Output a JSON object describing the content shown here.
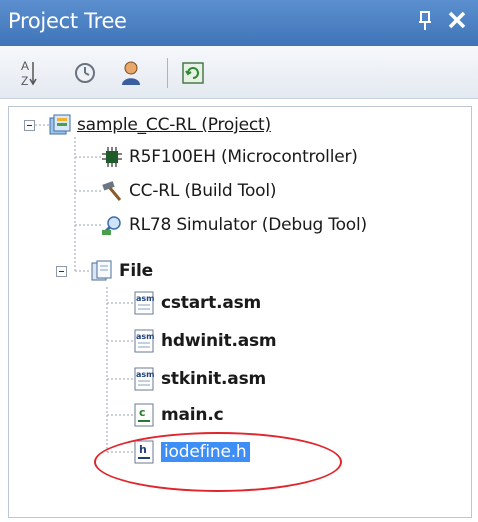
{
  "panel": {
    "title": "Project Tree",
    "close_label": "✕"
  },
  "toolbar": {
    "sort_icon_text": "A\nZ"
  },
  "tree": {
    "root": {
      "label": "sample_CC-RL (Project)"
    },
    "items": [
      {
        "label": "R5F100EH (Microcontroller)",
        "icon": "microcontroller-icon"
      },
      {
        "label": "CC-RL (Build Tool)",
        "icon": "hammer-icon"
      },
      {
        "label": "RL78 Simulator (Debug Tool)",
        "icon": "debug-tool-icon"
      },
      {
        "label": "File",
        "icon": "folder-file-icon"
      }
    ],
    "files": [
      {
        "label": "cstart.asm",
        "icon": "asm-file-icon",
        "tag": "asm"
      },
      {
        "label": "hdwinit.asm",
        "icon": "asm-file-icon",
        "tag": "asm"
      },
      {
        "label": "stkinit.asm",
        "icon": "asm-file-icon",
        "tag": "asm"
      },
      {
        "label": "main.c",
        "icon": "c-file-icon",
        "tag": "c"
      },
      {
        "label": "iodefine.h",
        "icon": "h-file-icon",
        "tag": "h"
      }
    ]
  },
  "colors": {
    "titlebar": "#4a80c4",
    "selection": "#3e8ef7",
    "highlight_ellipse": "#e0262c"
  }
}
